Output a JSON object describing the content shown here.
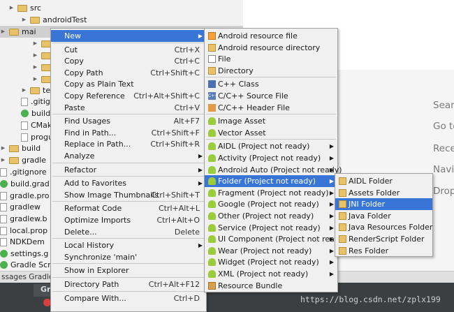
{
  "tree": {
    "rows": [
      {
        "label": "src",
        "indent": 1
      },
      {
        "label": "androidTest",
        "indent": 2
      },
      {
        "label": "mai",
        "indent": 2
      },
      {
        "label": "",
        "indent": 3
      },
      {
        "label": "",
        "indent": 3
      },
      {
        "label": "",
        "indent": 3
      },
      {
        "label": "",
        "indent": 3
      },
      {
        "label": "tes",
        "indent": 2
      },
      {
        "label": ".gitign",
        "indent": 2
      },
      {
        "label": "build.g",
        "indent": 2
      },
      {
        "label": "CMake",
        "indent": 2
      },
      {
        "label": "progua",
        "indent": 2
      },
      {
        "label": "build",
        "indent": 0
      },
      {
        "label": "gradle",
        "indent": 0
      },
      {
        "label": ".gitignore",
        "indent": 0
      },
      {
        "label": "build.grad",
        "indent": 0
      },
      {
        "label": "gradle.pro",
        "indent": 0
      },
      {
        "label": "gradlew",
        "indent": 0
      },
      {
        "label": "gradlew.b",
        "indent": 0
      },
      {
        "label": "local.prop",
        "indent": 0
      },
      {
        "label": "NDKDem",
        "indent": 0
      },
      {
        "label": "settings.g",
        "indent": 0
      },
      {
        "label": "Gradle Script",
        "indent": 0
      }
    ]
  },
  "toolstrip": {
    "text": "ssages Gradle Syn"
  },
  "bottom": {
    "tab": "Gra"
  },
  "editor_hints": [
    "Searc",
    "Go to",
    "Rece",
    "Navig",
    "Drop"
  ],
  "context_menu": [
    {
      "label": "New",
      "shortcut": "",
      "submenu": true,
      "highlight": true
    },
    {
      "sep": true
    },
    {
      "label": "Cut",
      "shortcut": "Ctrl+X"
    },
    {
      "label": "Copy",
      "shortcut": "Ctrl+C"
    },
    {
      "label": "Copy Path",
      "shortcut": "Ctrl+Shift+C"
    },
    {
      "label": "Copy as Plain Text",
      "shortcut": ""
    },
    {
      "label": "Copy Reference",
      "shortcut": "Ctrl+Alt+Shift+C"
    },
    {
      "label": "Paste",
      "shortcut": "Ctrl+V"
    },
    {
      "sep": true
    },
    {
      "label": "Find Usages",
      "shortcut": "Alt+F7"
    },
    {
      "label": "Find in Path...",
      "shortcut": "Ctrl+Shift+F"
    },
    {
      "label": "Replace in Path...",
      "shortcut": "Ctrl+Shift+R"
    },
    {
      "label": "Analyze",
      "shortcut": "",
      "submenu": true
    },
    {
      "sep": true
    },
    {
      "label": "Refactor",
      "shortcut": "",
      "submenu": true
    },
    {
      "sep": true
    },
    {
      "label": "Add to Favorites",
      "shortcut": "",
      "submenu": true
    },
    {
      "label": "Show Image Thumbnails",
      "shortcut": "Ctrl+Shift+T"
    },
    {
      "sep": true
    },
    {
      "label": "Reformat Code",
      "shortcut": "Ctrl+Alt+L"
    },
    {
      "label": "Optimize Imports",
      "shortcut": "Ctrl+Alt+O"
    },
    {
      "label": "Delete...",
      "shortcut": "Delete"
    },
    {
      "sep": true
    },
    {
      "label": "Local History",
      "shortcut": "",
      "submenu": true
    },
    {
      "label": "Synchronize 'main'",
      "shortcut": ""
    },
    {
      "sep": true
    },
    {
      "label": "Show in Explorer",
      "shortcut": ""
    },
    {
      "sep": true
    },
    {
      "label": "Directory Path",
      "shortcut": "Ctrl+Alt+F12"
    },
    {
      "sep": true
    },
    {
      "label": "Compare With...",
      "shortcut": "Ctrl+D"
    }
  ],
  "new_menu": [
    {
      "label": "Android resource file",
      "icon": "res"
    },
    {
      "label": "Android resource directory",
      "icon": "fold"
    },
    {
      "label": "File",
      "icon": "doc"
    },
    {
      "label": "Directory",
      "icon": "fold"
    },
    {
      "sep": true
    },
    {
      "label": "C++ Class",
      "icon": "ch"
    },
    {
      "label": "C/C++ Source File",
      "icon": "cpp"
    },
    {
      "label": "C/C++ Header File",
      "icon": "hdr"
    },
    {
      "sep": true
    },
    {
      "label": "Image Asset",
      "icon": "and"
    },
    {
      "label": "Vector Asset",
      "icon": "and"
    },
    {
      "sep": true
    },
    {
      "label": "AIDL (Project not ready)",
      "icon": "and",
      "submenu": true
    },
    {
      "label": "Activity (Project not ready)",
      "icon": "and",
      "submenu": true
    },
    {
      "label": "Android Auto (Project not ready)",
      "icon": "and",
      "submenu": true
    },
    {
      "label": "Folder (Project not ready)",
      "icon": "and",
      "submenu": true,
      "highlight": true
    },
    {
      "label": "Fragment (Project not ready)",
      "icon": "and",
      "submenu": true
    },
    {
      "label": "Google (Project not ready)",
      "icon": "and",
      "submenu": true
    },
    {
      "label": "Other (Project not ready)",
      "icon": "and",
      "submenu": true
    },
    {
      "label": "Service (Project not ready)",
      "icon": "and",
      "submenu": true
    },
    {
      "label": "UI Component (Project not ready)",
      "icon": "and",
      "submenu": true
    },
    {
      "label": "Wear (Project not ready)",
      "icon": "and",
      "submenu": true
    },
    {
      "label": "Widget (Project not ready)",
      "icon": "and",
      "submenu": true
    },
    {
      "label": "XML (Project not ready)",
      "icon": "and",
      "submenu": true
    },
    {
      "label": "Resource Bundle",
      "icon": "bundle"
    }
  ],
  "folder_menu": [
    {
      "label": "AIDL Folder"
    },
    {
      "label": "Assets Folder"
    },
    {
      "label": "JNI Folder",
      "highlight": true
    },
    {
      "label": "Java Folder"
    },
    {
      "label": "Java Resources Folder"
    },
    {
      "label": "RenderScript Folder"
    },
    {
      "label": "Res Folder"
    }
  ],
  "watermark": "https://blog.csdn.net/zplx199"
}
